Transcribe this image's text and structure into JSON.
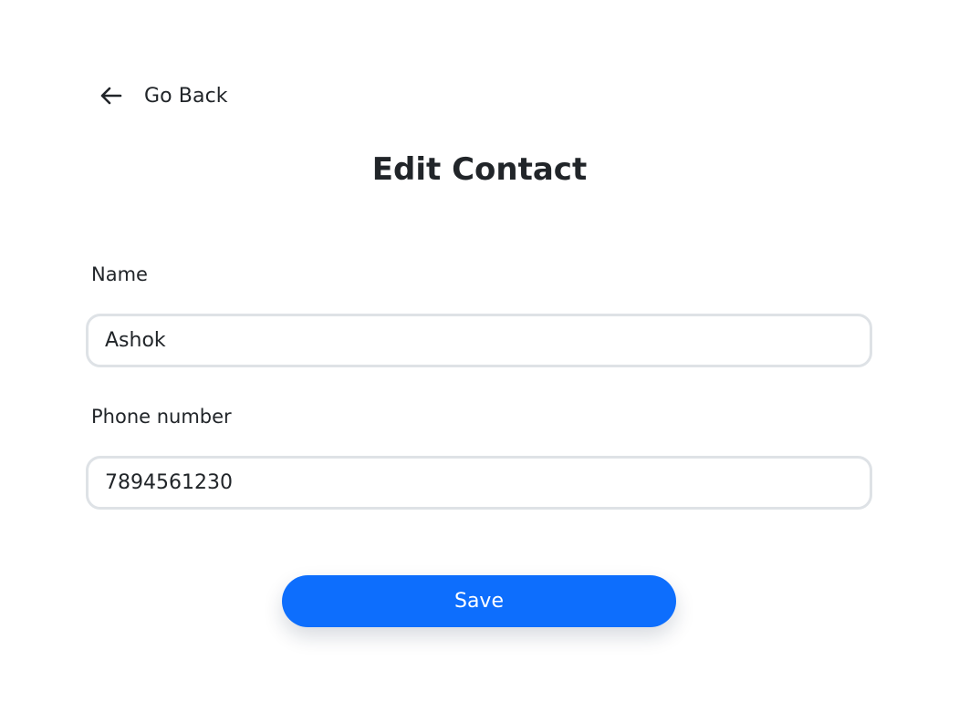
{
  "nav": {
    "back_label": "Go Back",
    "back_icon": "arrow-left-icon"
  },
  "page": {
    "title": "Edit Contact"
  },
  "form": {
    "name": {
      "label": "Name",
      "value": "Ashok"
    },
    "phone": {
      "label": "Phone number",
      "value": "7894561230"
    },
    "save_label": "Save"
  },
  "colors": {
    "primary": "#0d6efd",
    "text": "#212529",
    "input_border": "#dee2e6",
    "background": "#ffffff"
  }
}
